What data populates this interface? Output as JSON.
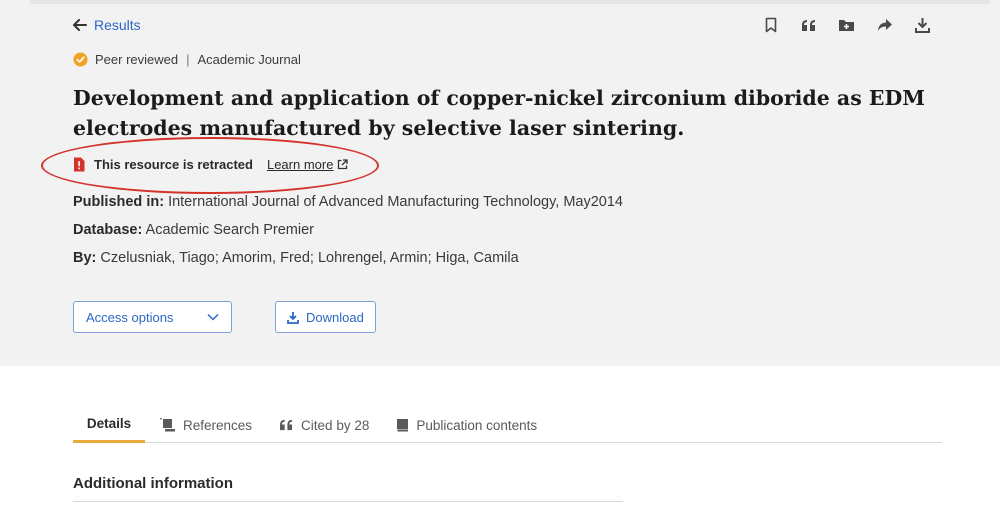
{
  "nav": {
    "back_label": "Results"
  },
  "toolbar": {
    "icons": [
      "bookmark-icon",
      "cite-icon",
      "add-to-folder-icon",
      "share-icon",
      "download-icon"
    ]
  },
  "article": {
    "peer_reviewed": "Peer reviewed",
    "separator": "|",
    "type": "Academic Journal",
    "title": "Development and application of copper-nickel zirconium diboride as EDM electrodes manufactured by selective laser sintering.",
    "retraction": {
      "label": "This resource is retracted",
      "link_label": "Learn more"
    },
    "published_in_label": "Published in:",
    "published_in_value": "International Journal of Advanced Manufacturing Technology, May2014",
    "database_label": "Database:",
    "database_value": "Academic Search Premier",
    "by_label": "By:",
    "by_value": "Czelusniak, Tiago; Amorim, Fred; Lohrengel, Armin; Higa, Camila"
  },
  "actions": {
    "access_label": "Access options",
    "download_label": "Download"
  },
  "tabs": [
    {
      "label": "Details",
      "active": true
    },
    {
      "label": "References"
    },
    {
      "label": "Cited by 28"
    },
    {
      "label": "Publication contents"
    }
  ],
  "section": {
    "heading": "Additional information"
  },
  "colors": {
    "accent": "#2a68c6",
    "header_bg": "#f2f2f2",
    "tab_active": "#e8a93b",
    "retracted_red": "#d4332b",
    "badge": "#f0a425"
  }
}
